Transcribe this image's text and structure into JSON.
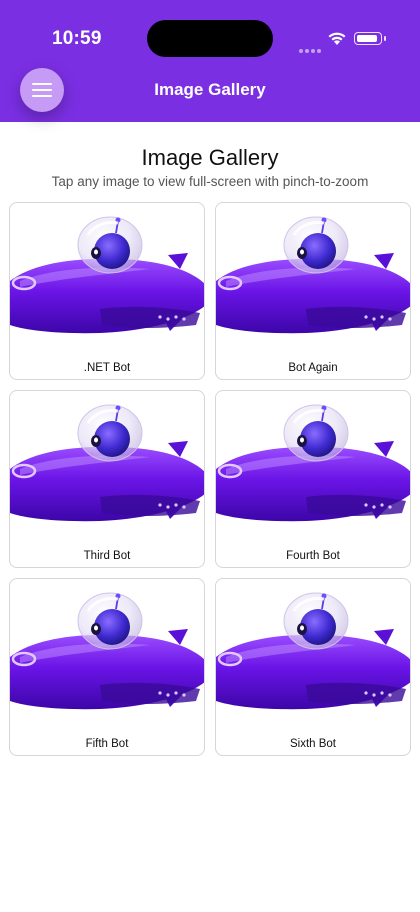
{
  "status_bar": {
    "time": "10:59"
  },
  "header": {
    "title": "Image Gallery",
    "menu_icon": "hamburger-icon",
    "color": "#7b2fe3"
  },
  "page": {
    "title": "Image Gallery",
    "subtitle": "Tap any image to view full-screen with pinch-to-zoom"
  },
  "gallery": {
    "items": [
      {
        "label": ".NET Bot"
      },
      {
        "label": "Bot Again"
      },
      {
        "label": "Third Bot"
      },
      {
        "label": "Fourth Bot"
      },
      {
        "label": "Fifth Bot"
      },
      {
        "label": "Sixth Bot"
      }
    ]
  }
}
